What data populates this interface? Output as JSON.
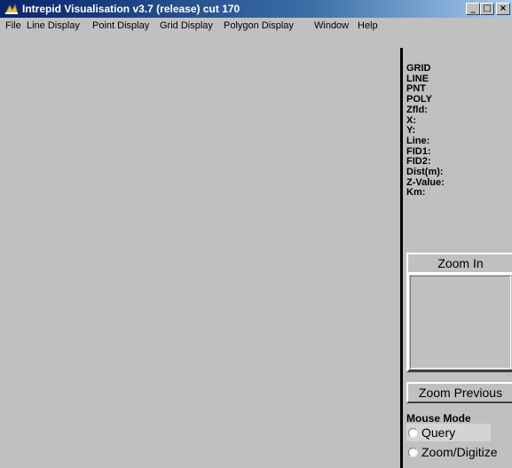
{
  "window": {
    "title": "Intrepid Visualisation v3.7 (release) cut 170",
    "icon": "intrepid-app-icon",
    "caption_buttons": {
      "minimize": "_",
      "maximize": "□",
      "close": "×"
    }
  },
  "menu": {
    "items": [
      "File",
      "Line Display",
      "Point Display",
      "Grid Display",
      "Polygon Display",
      "Window",
      "Help"
    ]
  },
  "info_panel": {
    "lines": [
      "GRID",
      "LINE",
      "PNT",
      "POLY",
      "Zfld:",
      "X:",
      "Y:",
      "Line:",
      "FID1:",
      "FID2:",
      "Dist(m):",
      "Z-Value:",
      "Km:"
    ]
  },
  "zoom": {
    "zoom_in_label": "Zoom In",
    "zoom_previous_label": "Zoom Previous"
  },
  "mouse_mode": {
    "label": "Mouse Mode",
    "options": [
      "Query",
      "Zoom/Digitize"
    ]
  }
}
